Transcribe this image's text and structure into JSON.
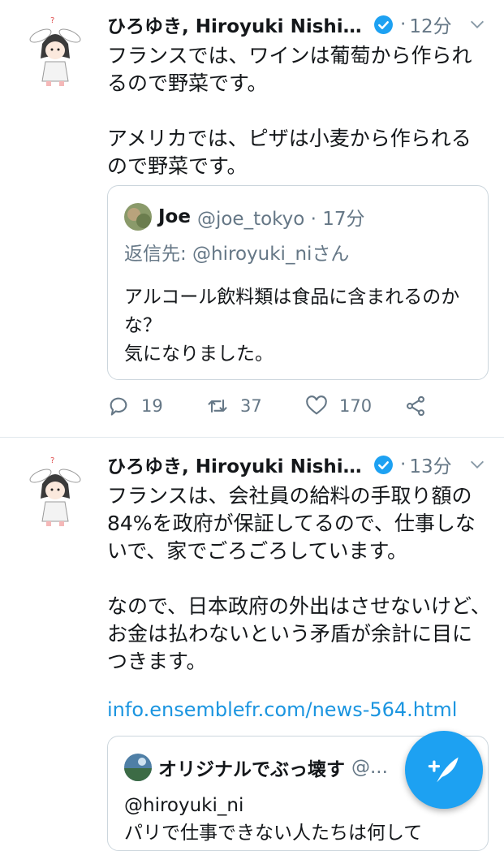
{
  "tweets": [
    {
      "author_name": "ひろゆき, Hiroyuki Nishim...",
      "time": "12分",
      "separator": "·",
      "text": "フランスでは、ワインは葡萄から作られるので野菜です。\n\nアメリカでは、ピザは小麦から作られるので野菜です。",
      "quote": {
        "name": "Joe",
        "handle": "@joe_tokyo · 17分",
        "reply_to": "返信先: @hiroyuki_niさん",
        "text": "アルコール飲料類は食品に含まれるのかな？\n気になりました。"
      },
      "actions": {
        "reply_count": "19",
        "retweet_count": "37",
        "like_count": "170"
      }
    },
    {
      "author_name": "ひろゆき, Hiroyuki Nishim...",
      "time": "13分",
      "separator": "·",
      "text": "フランスは、会社員の給料の手取り額の84%を政府が保証してるので、仕事しないで、家でごろごろしています。\n\nなので、日本政府の外出はさせないけど、お金は払わないという矛盾が余計に目につきます。",
      "link": "info.ensemblefr.com/news-564.html",
      "quote": {
        "name": "オリジナルでぶっ壊す",
        "handle": "@...",
        "reply_to": "@hiroyuki_ni",
        "text": "パリで仕事できない人たちは何して"
      }
    }
  ],
  "icons": {
    "verified": "verified-badge-icon",
    "chevron": "chevron-down-icon",
    "reply": "reply-icon",
    "retweet": "retweet-icon",
    "like": "heart-icon",
    "share": "share-icon",
    "compose": "compose-tweet-icon"
  },
  "colors": {
    "brand": "#1da1f2",
    "link": "#1b95e0",
    "secondary_text": "#657786",
    "border": "#ccd6dd"
  }
}
